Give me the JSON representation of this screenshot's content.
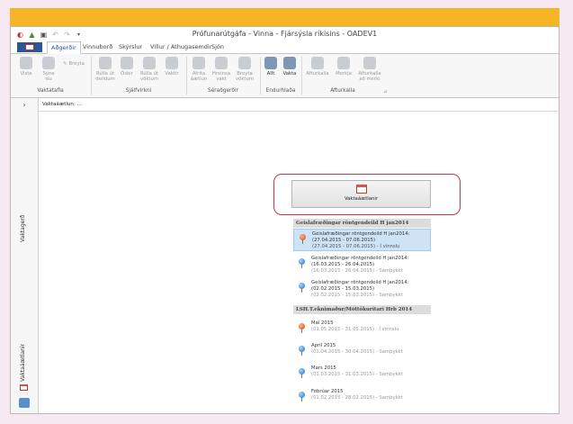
{
  "window": {
    "title": "Prófunarútgáfa - Vinna - Fjársýsla ríkisins - OADEV1"
  },
  "tabs": [
    "Aðgerðir",
    "Vinnuborð",
    "Skýrslur",
    "Villur / Athugasemdir",
    "Sjón"
  ],
  "ribbon": {
    "buttons": {
      "vista": "Vista",
      "syna_sia": "Sýna síu",
      "breyta": "Breyta",
      "rulla_ut_deildum": "Rúlla út deildum",
      "oskir": "Óskir",
      "rulla_ut_voktum": "Rúlla út vöktum",
      "vaktir": "Vaktir",
      "afrita_aaetlun": "Afrita áætlun",
      "hreinsa_vakt": "Hreinsa vakt",
      "breyta_voktum": "Breyta vöktum",
      "allt": "Allt",
      "vakta": "Vakta",
      "afturkalla": "Afturkalla",
      "merkja": "Merkja",
      "afturkalla_ad_merki": "Afturkalla að merki"
    },
    "groups": {
      "vaktatafla": "Vaktatafla",
      "sjalfvirkni": "Sjálfvirkni",
      "seradgerdir": "Séraðgerðir",
      "endurhladа": "Endurhlaða",
      "afturkalla": "Afturkalla"
    }
  },
  "sidebar": {
    "bottom_label": "Vaktaáætlanir",
    "main_label": "Vaktagerð"
  },
  "content": {
    "header": "Vaktaáætlun: ...",
    "main_button": "Vaktaáætlanir",
    "groups": [
      {
        "title": "Geislafræðingar röntgendeild H jan2014",
        "items": [
          {
            "name": "Geislafræðingar röntgendeild H jan2014: (27.04.2015 - 07.06.2015)",
            "detail": "(27.04.2015 - 07.06.2015) - Í vinnslu",
            "pin": "red",
            "selected": true
          },
          {
            "name": "Geislafræðingar röntgendeild H jan2014: (16.03.2015 - 26.04.2015)",
            "detail": "(16.03.2015 - 26.04.2015) - Samþykkt",
            "pin": "blue",
            "selected": false
          },
          {
            "name": "Geislafræðingar röntgendeild H jan2014: (02.02.2015 - 15.03.2015)",
            "detail": "(02.02.2015 - 15.03.2015) - Samþykkt",
            "pin": "blue",
            "selected": false
          }
        ]
      },
      {
        "title": "LSH.T.eknimaður/Móttökuritari Hrb 2014",
        "items": [
          {
            "name": "Maí 2015",
            "detail": "(01.05.2015 - 31.05.2015) - Í vinnslu",
            "pin": "red",
            "selected": false
          },
          {
            "name": "Apríl 2015",
            "detail": "(01.04.2015 - 30.04.2015) - Samþykkt",
            "pin": "blue",
            "selected": false
          },
          {
            "name": "Mars 2015",
            "detail": "(01.03.2015 - 31.03.2015) - Samþykkt",
            "pin": "blue",
            "selected": false
          },
          {
            "name": "Febrúar 2015",
            "detail": "(01.02.2015 - 28.02.2015) - Samþykkt",
            "pin": "blue",
            "selected": false
          }
        ]
      }
    ]
  },
  "colors": {
    "top_bar": "#f7b526",
    "accent": "#2b579a",
    "highlight": "#c0394b",
    "selected_row": "#cfe3f7"
  }
}
